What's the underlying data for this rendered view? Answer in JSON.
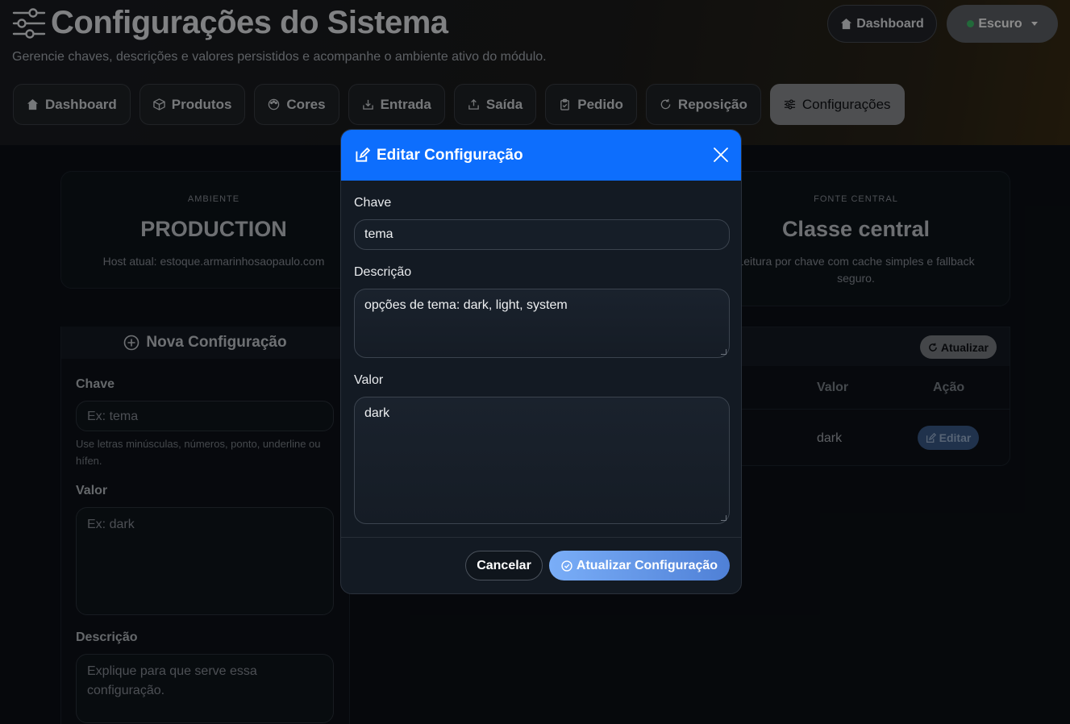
{
  "header": {
    "title": "Configurações do Sistema",
    "subtitle": "Gerencie chaves, descrições e valores persistidos e acompanhe o ambiente ativo do módulo.",
    "dashboard_button": "Dashboard",
    "theme_button": "Escuro"
  },
  "nav": {
    "tabs": [
      {
        "label": "Dashboard",
        "icon": "home-icon"
      },
      {
        "label": "Produtos",
        "icon": "box-icon"
      },
      {
        "label": "Cores",
        "icon": "palette-icon"
      },
      {
        "label": "Entrada",
        "icon": "download-icon"
      },
      {
        "label": "Saída",
        "icon": "upload-icon"
      },
      {
        "label": "Pedido",
        "icon": "clipboard-icon"
      },
      {
        "label": "Reposição",
        "icon": "refresh-icon"
      },
      {
        "label": "Configurações",
        "icon": "sliders-icon"
      }
    ],
    "active": "Configurações"
  },
  "cards": {
    "ambiente": {
      "label": "AMBIENTE",
      "value": "PRODUCTION",
      "desc": "Host atual: estoque.armarinhosaopaulo.com"
    },
    "fonte": {
      "label": "FONTE CENTRAL",
      "value": "Classe central",
      "desc": "Leitura por chave com cache simples e fallback seguro."
    }
  },
  "new_config": {
    "title": "Nova Configuração",
    "chave_label": "Chave",
    "chave_placeholder": "Ex: tema",
    "chave_hint": "Use letras minúsculas, números, ponto, underline ou hífen.",
    "valor_label": "Valor",
    "valor_placeholder": "Ex: dark",
    "descricao_label": "Descrição",
    "descricao_placeholder": "Explique para que serve essa configuração."
  },
  "list": {
    "refresh_button": "Atualizar",
    "col_valor": "Valor",
    "col_acao": "Ação",
    "row_valor": "dark",
    "edit_button": "Editar"
  },
  "modal": {
    "title": "Editar Configuração",
    "chave_label": "Chave",
    "chave_value": "tema",
    "descricao_label": "Descrição",
    "descricao_value": "opções de tema: dark, light, system",
    "valor_label": "Valor",
    "valor_value": "dark",
    "cancel_button": "Cancelar",
    "save_button": "Atualizar Configuração"
  },
  "colors": {
    "modal_header": "#0d6efd",
    "status_dot": "#3fbf6a"
  }
}
